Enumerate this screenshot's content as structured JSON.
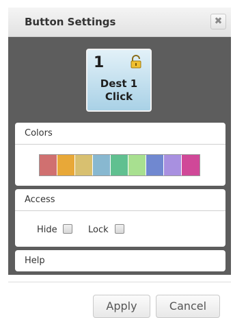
{
  "dialog": {
    "title": "Button Settings",
    "close_icon": "close-icon",
    "close_glyph": "✖"
  },
  "preview": {
    "number": "1",
    "label": "Dest 1\nClick",
    "lock_icon": "lock-icon",
    "background_color": "#a9d1e6"
  },
  "colors_section": {
    "header": "Colors",
    "swatches": [
      "#d07070",
      "#e8a838",
      "#d8c070",
      "#88b8d0",
      "#60c090",
      "#a8e090",
      "#7088d0",
      "#a890e0",
      "#d04898"
    ]
  },
  "access_section": {
    "header": "Access",
    "hide_label": "Hide",
    "hide_checked": false,
    "lock_label": "Lock",
    "lock_checked": false
  },
  "help_section": {
    "header": "Help"
  },
  "footer": {
    "apply_label": "Apply",
    "cancel_label": "Cancel"
  }
}
